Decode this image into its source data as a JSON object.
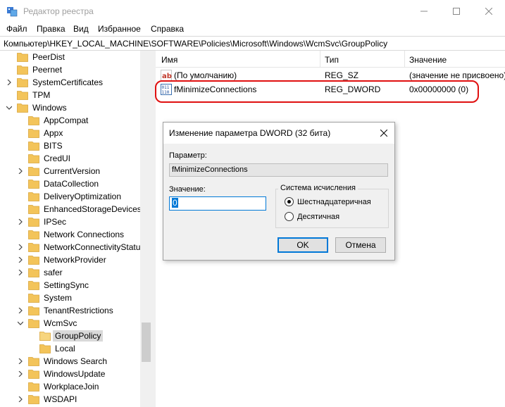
{
  "window": {
    "title": "Редактор реестра",
    "icon": "regedit-icon"
  },
  "menu": [
    "Файл",
    "Правка",
    "Вид",
    "Избранное",
    "Справка"
  ],
  "address": "Компьютер\\HKEY_LOCAL_MACHINE\\SOFTWARE\\Policies\\Microsoft\\Windows\\WcmSvc\\GroupPolicy",
  "tree": {
    "items": [
      {
        "label": "PeerDist",
        "expandable": false,
        "level": 1
      },
      {
        "label": "Peernet",
        "expandable": false,
        "level": 1
      },
      {
        "label": "SystemCertificates",
        "expandable": true,
        "level": 1
      },
      {
        "label": "TPM",
        "expandable": false,
        "level": 1
      },
      {
        "label": "Windows",
        "expandable": true,
        "expanded": true,
        "level": 1
      },
      {
        "label": "AppCompat",
        "expandable": false,
        "level": 2
      },
      {
        "label": "Appx",
        "expandable": false,
        "level": 2
      },
      {
        "label": "BITS",
        "expandable": false,
        "level": 2
      },
      {
        "label": "CredUI",
        "expandable": false,
        "level": 2
      },
      {
        "label": "CurrentVersion",
        "expandable": true,
        "level": 2
      },
      {
        "label": "DataCollection",
        "expandable": false,
        "level": 2
      },
      {
        "label": "DeliveryOptimization",
        "expandable": false,
        "level": 2
      },
      {
        "label": "EnhancedStorageDevices",
        "expandable": false,
        "level": 2
      },
      {
        "label": "IPSec",
        "expandable": true,
        "level": 2
      },
      {
        "label": "Network Connections",
        "expandable": false,
        "level": 2
      },
      {
        "label": "NetworkConnectivityStatus",
        "expandable": true,
        "level": 2
      },
      {
        "label": "NetworkProvider",
        "expandable": true,
        "level": 2
      },
      {
        "label": "safer",
        "expandable": true,
        "level": 2
      },
      {
        "label": "SettingSync",
        "expandable": false,
        "level": 2
      },
      {
        "label": "System",
        "expandable": false,
        "level": 2
      },
      {
        "label": "TenantRestrictions",
        "expandable": true,
        "level": 2
      },
      {
        "label": "WcmSvc",
        "expandable": true,
        "expanded": true,
        "level": 2
      },
      {
        "label": "GroupPolicy",
        "expandable": false,
        "level": 3,
        "selected": true
      },
      {
        "label": "Local",
        "expandable": false,
        "level": 3
      },
      {
        "label": "Windows Search",
        "expandable": true,
        "level": 2
      },
      {
        "label": "WindowsUpdate",
        "expandable": true,
        "level": 2
      },
      {
        "label": "WorkplaceJoin",
        "expandable": false,
        "level": 2
      },
      {
        "label": "WSDAPI",
        "expandable": true,
        "level": 2
      }
    ]
  },
  "list": {
    "columns": {
      "name": "Имя",
      "type": "Тип",
      "value": "Значение"
    },
    "rows": [
      {
        "name": "(По умолчанию)",
        "type": "REG_SZ",
        "value": "(значение не присвоено)",
        "icon": "string-value-icon"
      },
      {
        "name": "fMinimizeConnections",
        "type": "REG_DWORD",
        "value": "0x00000000 (0)",
        "icon": "dword-value-icon"
      }
    ]
  },
  "dialog": {
    "title": "Изменение параметра DWORD (32 бита)",
    "param_label": "Параметр:",
    "param_value": "fMinimizeConnections",
    "value_label": "Значение:",
    "value": "0",
    "base_label": "Система исчисления",
    "base_hex": "Шестнадцатеричная",
    "base_dec": "Десятичная",
    "selected_base": "hex",
    "ok": "OK",
    "cancel": "Отмена"
  },
  "colors": {
    "folder": "#f3c45a",
    "highlight": "#e01010",
    "accent": "#0078d7"
  }
}
